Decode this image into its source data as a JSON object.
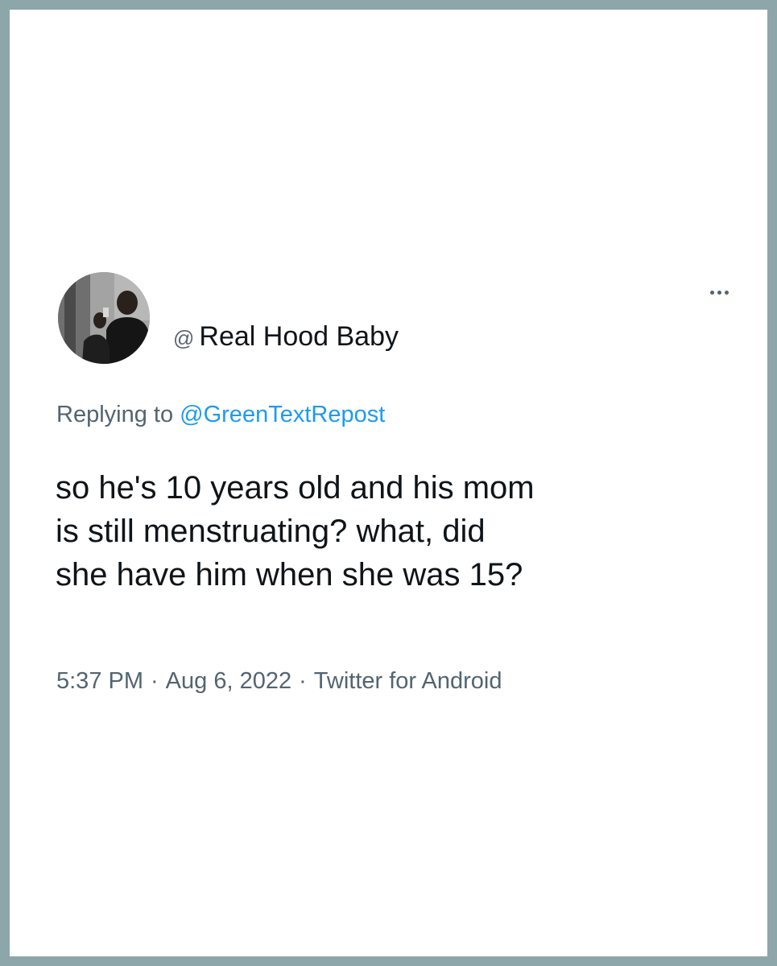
{
  "tweet": {
    "at_prefix": "@",
    "display_name": "Real Hood Baby",
    "replying_prefix": "Replying to",
    "replying_to": "@GreenTextRepost",
    "text_lines": [
      "so he's 10 years old and his mom",
      "is still menstruating? what, did",
      "she have him when she was 15?"
    ],
    "time": "5:37 PM",
    "separator": "·",
    "date": "Aug 6, 2022",
    "source": "Twitter for Android"
  },
  "icons": {
    "more": "more-horizontal-icon",
    "avatar": "profile-photo"
  },
  "colors": {
    "border": "#8da6aa",
    "background": "#ffffff",
    "text_primary": "#0f1419",
    "text_secondary": "#536471",
    "link": "#1d9bf0"
  }
}
